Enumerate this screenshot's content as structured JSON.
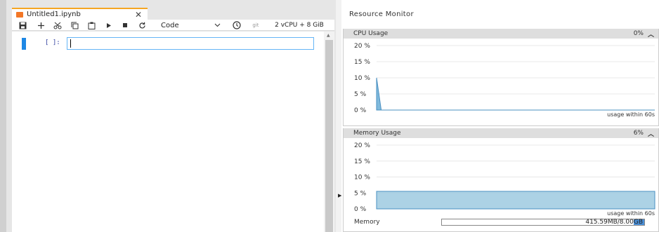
{
  "notebook": {
    "tab": {
      "name": "Untitled1.ipynb",
      "close": "✕"
    },
    "toolbar": {
      "cell_type": "Code",
      "git": "git",
      "kernel": "2 vCPU + 8 GiB"
    },
    "cell": {
      "prompt": "[ ]:",
      "value": ""
    }
  },
  "monitor": {
    "title": "Resource Monitor",
    "cpu": {
      "label": "CPU Usage",
      "percent": "0%",
      "footer": "usage within 60s"
    },
    "memory": {
      "label": "Memory Usage",
      "percent": "6%",
      "footer": "usage within 60s",
      "row_label": "Memory",
      "value": "415.59MB/8.00GB",
      "fraction": 0.051
    }
  },
  "chart_data": [
    {
      "type": "area",
      "title": "CPU Usage",
      "y_ticks": [
        "20 %",
        "15 %",
        "10 %",
        "5 %",
        "0 %"
      ],
      "ylim": [
        0,
        20
      ],
      "x": [
        0,
        1,
        2,
        60
      ],
      "values": [
        10,
        0,
        0,
        0
      ],
      "xlabel": "usage within 60s",
      "color": "#6aaed6"
    },
    {
      "type": "area",
      "title": "Memory Usage",
      "y_ticks": [
        "20 %",
        "15 %",
        "10 %",
        "5 %",
        "0 %"
      ],
      "ylim": [
        0,
        20
      ],
      "x": [
        0,
        60
      ],
      "values": [
        5.5,
        5.5
      ],
      "xlabel": "usage within 60s",
      "color": "#9ecae1"
    }
  ],
  "colors": {
    "accent": "#1e88e5",
    "tab_accent": "#f5a623",
    "area_stroke": "#4a90c2"
  }
}
